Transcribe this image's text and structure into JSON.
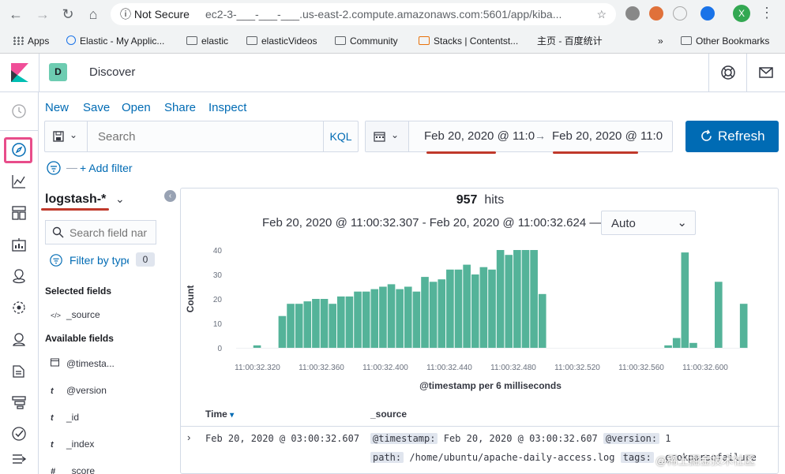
{
  "browser": {
    "security_label": "Not Secure",
    "url": "ec2-3-___-___-___.us-east-2.compute.amazonaws.com:5601/app/kiba...",
    "avatar_letter": "X",
    "bookmarks": [
      "Apps",
      "Elastic - My Applic...",
      "elastic",
      "elasticVideos",
      "Community",
      "Stacks | Contentst...",
      "主页 - 百度统计",
      "»",
      "Other Bookmarks"
    ]
  },
  "header": {
    "space_initial": "D",
    "title": "Discover"
  },
  "topnav": [
    "New",
    "Save",
    "Open",
    "Share",
    "Inspect"
  ],
  "query": {
    "placeholder": "Search",
    "language": "KQL"
  },
  "time": {
    "start": "Feb 20, 2020 @ 11:0",
    "arrow": "→",
    "end": "Feb 20, 2020 @ 11:0",
    "refresh_label": "Refresh"
  },
  "filters": {
    "add_label": "+ Add filter"
  },
  "sidebar": {
    "index_pattern": "logstash-*",
    "field_search_placeholder": "Search field nar",
    "filter_by_type": "Filter by type",
    "filter_count": "0",
    "selected_title": "Selected fields",
    "selected_fields": [
      {
        "type": "</>",
        "name": "_source"
      }
    ],
    "available_title": "Available fields",
    "available_fields": [
      {
        "type": "cal",
        "name": "@timesta..."
      },
      {
        "type": "t",
        "name": "@version"
      },
      {
        "type": "t",
        "name": "_id"
      },
      {
        "type": "t",
        "name": "_index"
      },
      {
        "type": "#",
        "name": "_score"
      }
    ]
  },
  "results": {
    "hits_count": "957",
    "hits_label": "hits",
    "range_text": "Feb 20, 2020 @ 11:00:32.307 - Feb 20, 2020 @ 11:00:32.624 —",
    "interval": "Auto",
    "columns": [
      "Time",
      "_source"
    ],
    "row_time": "Feb 20, 2020 @ 03:00:32.607",
    "row_source_line1": {
      "k1": "@timestamp:",
      "v1": "Feb 20, 2020 @ 03:00:32.607",
      "k2": "@version:",
      "v2": "1"
    },
    "row_source_line2": {
      "k1": "path:",
      "v1": "/home/ubuntu/apache-daily-access.log",
      "k2": "tags:",
      "v2": "_grokparsefailure"
    }
  },
  "colors": {
    "bar": "#54b399",
    "link": "#006bb4",
    "highlight": "#e84d8a",
    "annotation": "#c0392b"
  },
  "chart_data": {
    "type": "bar",
    "xlabel": "@timestamp per 6 milliseconds",
    "ylabel": "Count",
    "ylim": [
      0,
      40
    ],
    "yticks": [
      0,
      10,
      20,
      30,
      40
    ],
    "x_tick_labels": [
      "11:00:32.320",
      "11:00:32.360",
      "11:00:32.400",
      "11:00:32.440",
      "11:00:32.480",
      "11:00:32.520",
      "11:00:32.560",
      "11:00:32.600"
    ],
    "values": [
      0,
      0,
      1,
      0,
      0,
      13,
      18,
      18,
      19,
      20,
      20,
      18,
      21,
      21,
      23,
      23,
      24,
      25,
      26,
      24,
      25,
      23,
      29,
      27,
      28,
      32,
      32,
      34,
      30,
      33,
      32,
      40,
      38,
      40,
      40,
      40,
      22,
      0,
      0,
      0,
      0,
      0,
      0,
      0,
      0,
      0,
      0,
      0,
      0,
      0,
      0,
      1,
      4,
      39,
      2,
      0,
      0,
      27,
      0,
      0,
      18
    ]
  }
}
